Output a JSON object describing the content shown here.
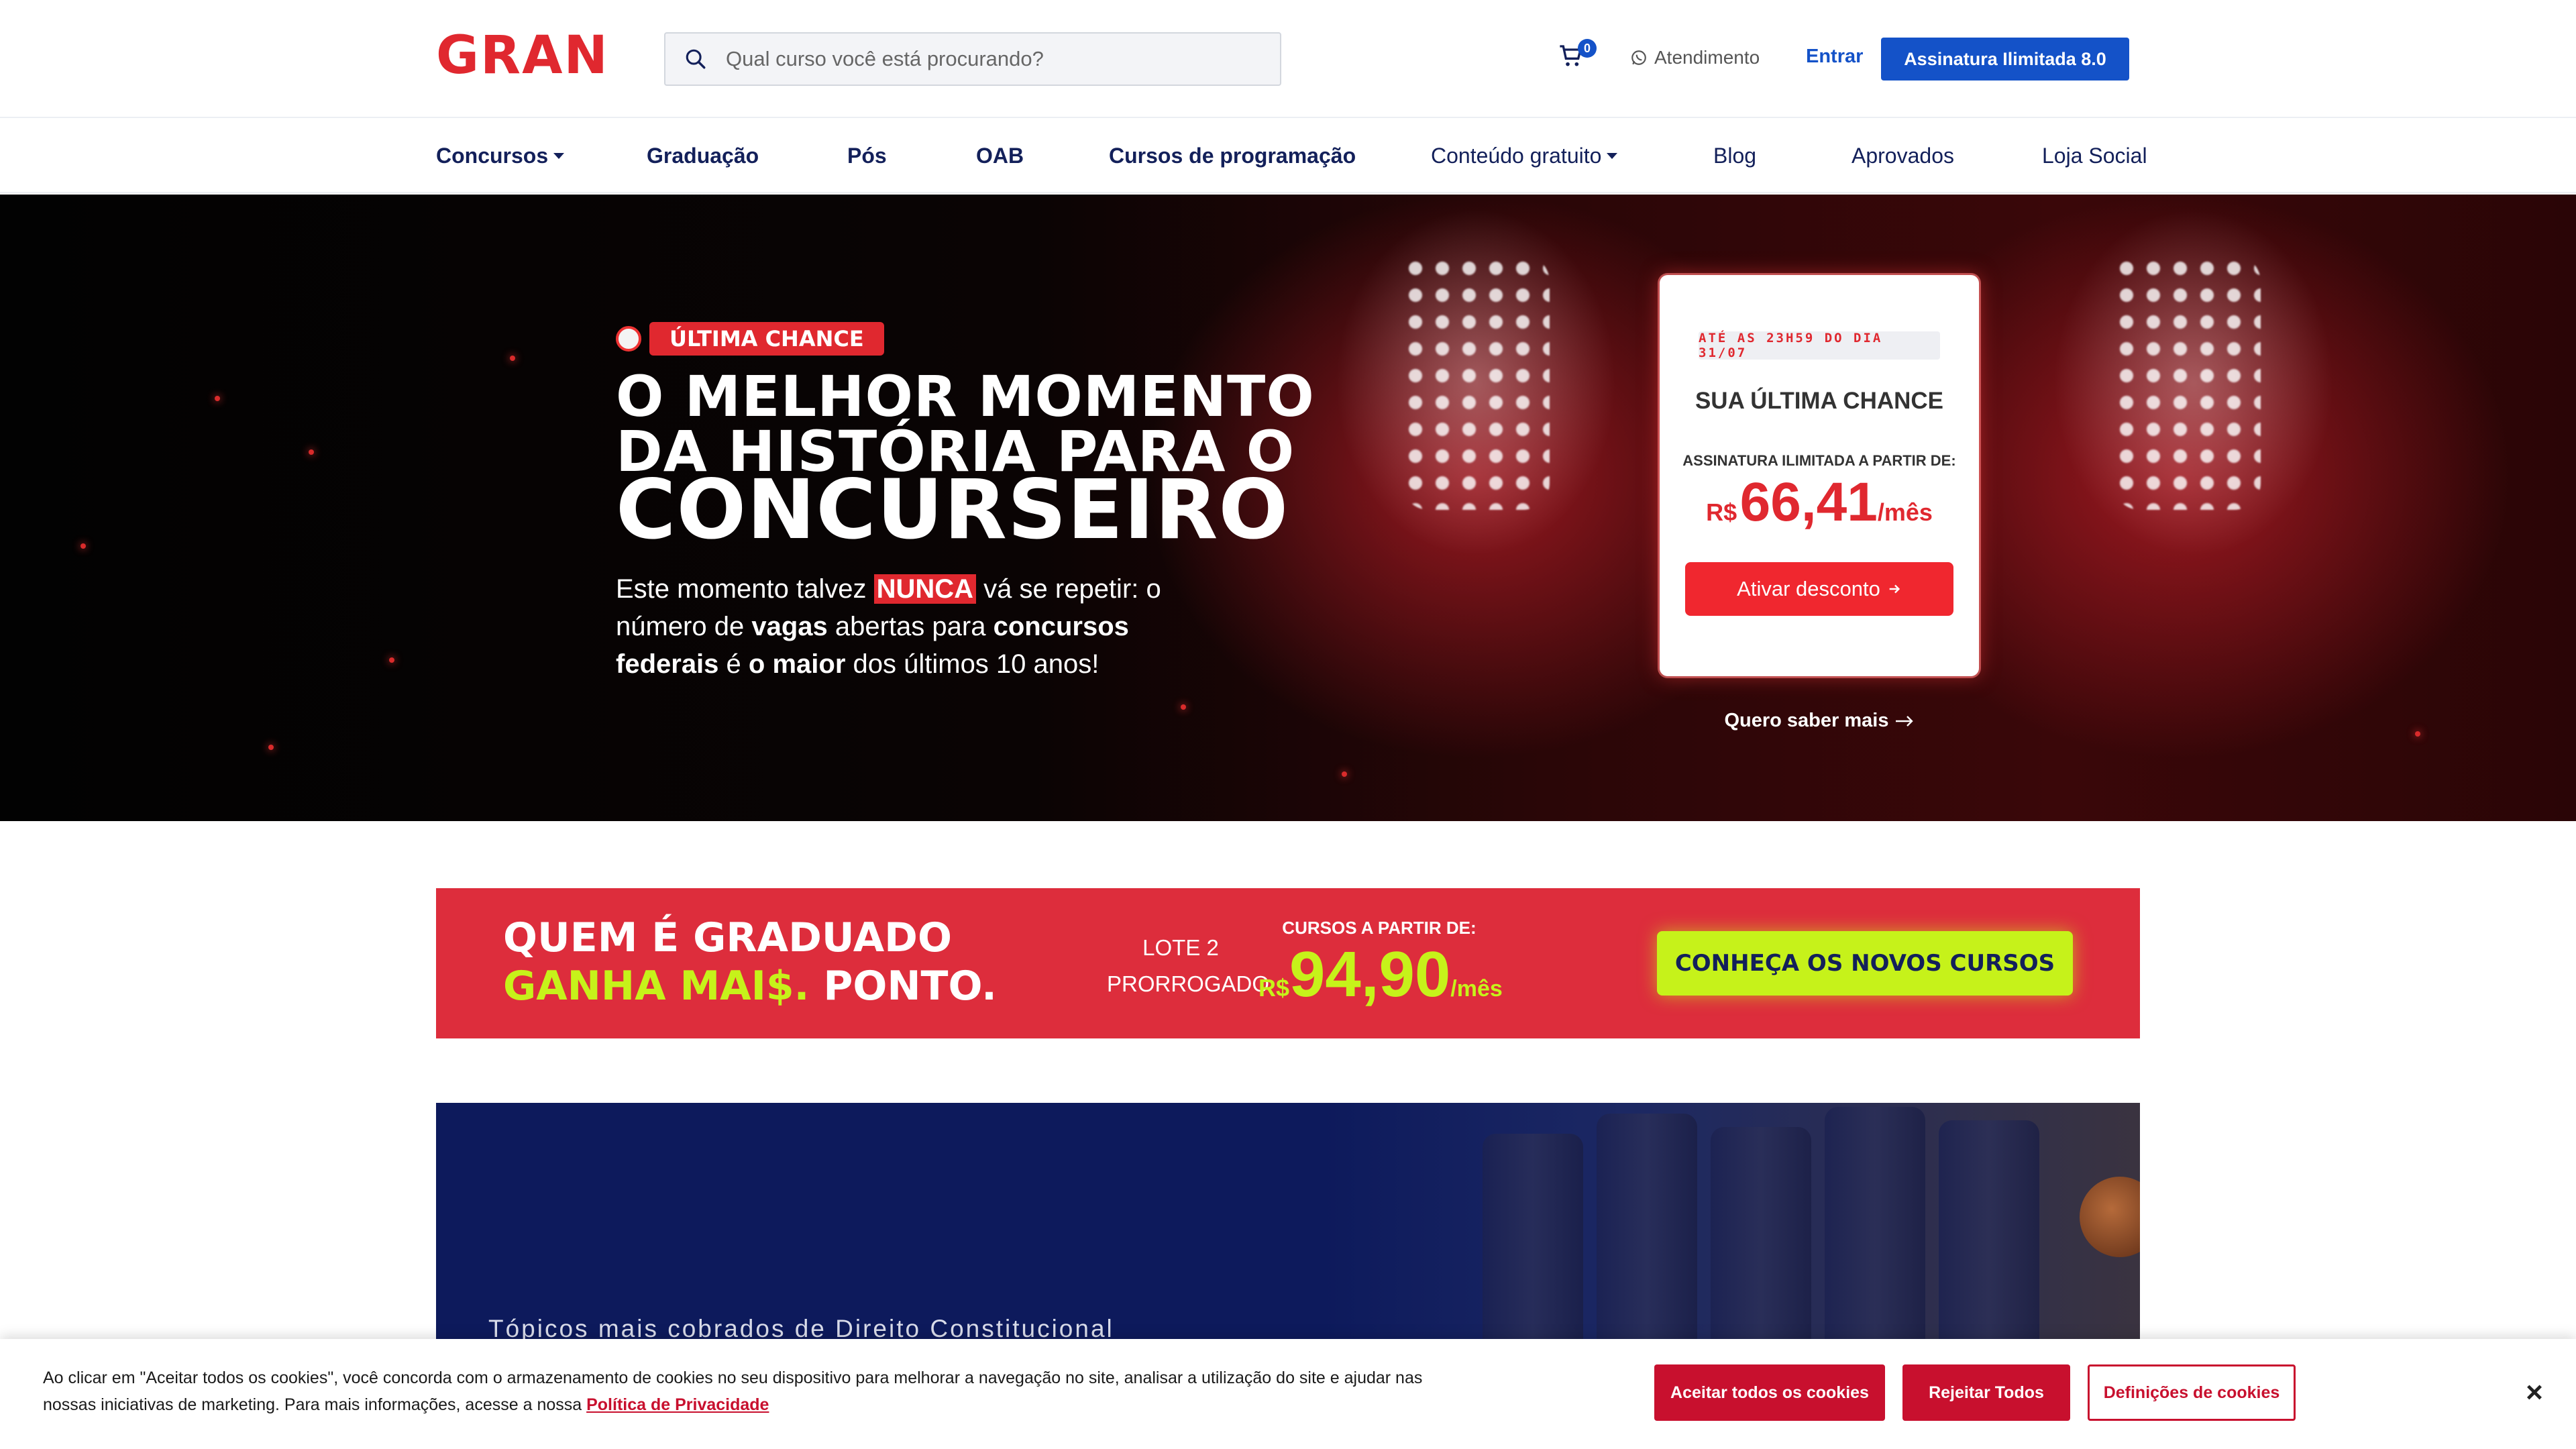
{
  "header": {
    "logo_text": "GRAN",
    "search_placeholder": "Qual curso você está procurando?",
    "cart_count": "0",
    "atendimento": "Atendimento",
    "entrar": "Entrar",
    "assinatura": "Assinatura  Ilimitada 8.0",
    "brand_color": "#13205a",
    "accent_color": "#1452c8"
  },
  "nav": {
    "items": [
      {
        "label": "Concursos",
        "dropdown": true
      },
      {
        "label": "Graduação"
      },
      {
        "label": "Pós"
      },
      {
        "label": "OAB"
      },
      {
        "label": "Cursos de programação"
      },
      {
        "label": "Conteúdo gratuito",
        "dropdown": true
      },
      {
        "label": "Blog"
      },
      {
        "label": "Aprovados"
      },
      {
        "label": "Loja Social"
      }
    ]
  },
  "hero": {
    "badge": "ÚLTIMA CHANCE",
    "title_line1": "O MELHOR MOMENTO",
    "title_line2": "DA HISTÓRIA PARA O",
    "title_line3": "CONCURSEIRO",
    "desc_1": "Este momento talvez ",
    "desc_highlight": "NUNCA",
    "desc_2": " vá se repetir: o número de ",
    "desc_vagas": "vagas",
    "desc_3": " abertas para ",
    "desc_concursos": "concursos federais",
    "desc_4": " é ",
    "desc_maior": "o maior",
    "desc_5": " dos últimos 10 anos!",
    "card": {
      "date": "ATÉ AS 23H59 DO DIA 31/07",
      "title": "SUA ÚLTIMA CHANCE",
      "subtitle": "ASSINATURA ILIMITADA A PARTIR DE:",
      "currency": "R$",
      "price": "66,41",
      "period": "/mês",
      "button": "Ativar desconto"
    },
    "quero": "Quero saber mais"
  },
  "promo": {
    "line1": "QUEM É GRADUADO",
    "line2_lime": "GANHA MAI$.",
    "line2_white": " PONTO.",
    "lote_1": "LOTE 2",
    "lote_2": "PRORROGADO",
    "cursos_label": "CURSOS A PARTIR DE:",
    "currency": "R$",
    "price": "94,90",
    "period": "/mês",
    "button": "CONHEÇA OS NOVOS CURSOS",
    "bg_color": "#dd2d3c",
    "lime_color": "#c6f21a"
  },
  "navy_banner": {
    "text": "Tópicos mais cobrados de Direito Constitucional"
  },
  "cookie": {
    "text": "Ao clicar em \"Aceitar todos os cookies\", você concorda com o armazenamento de cookies no seu dispositivo para melhorar a navegação no site, analisar a utilização do site e ajudar nas nossas iniciativas de marketing. Para mais informações, acesse a nossa ",
    "link": "Política de Privacidade",
    "accept": "Aceitar todos os cookies",
    "reject": "Rejeitar Todos",
    "settings": "Definições de cookies",
    "close": "×"
  }
}
